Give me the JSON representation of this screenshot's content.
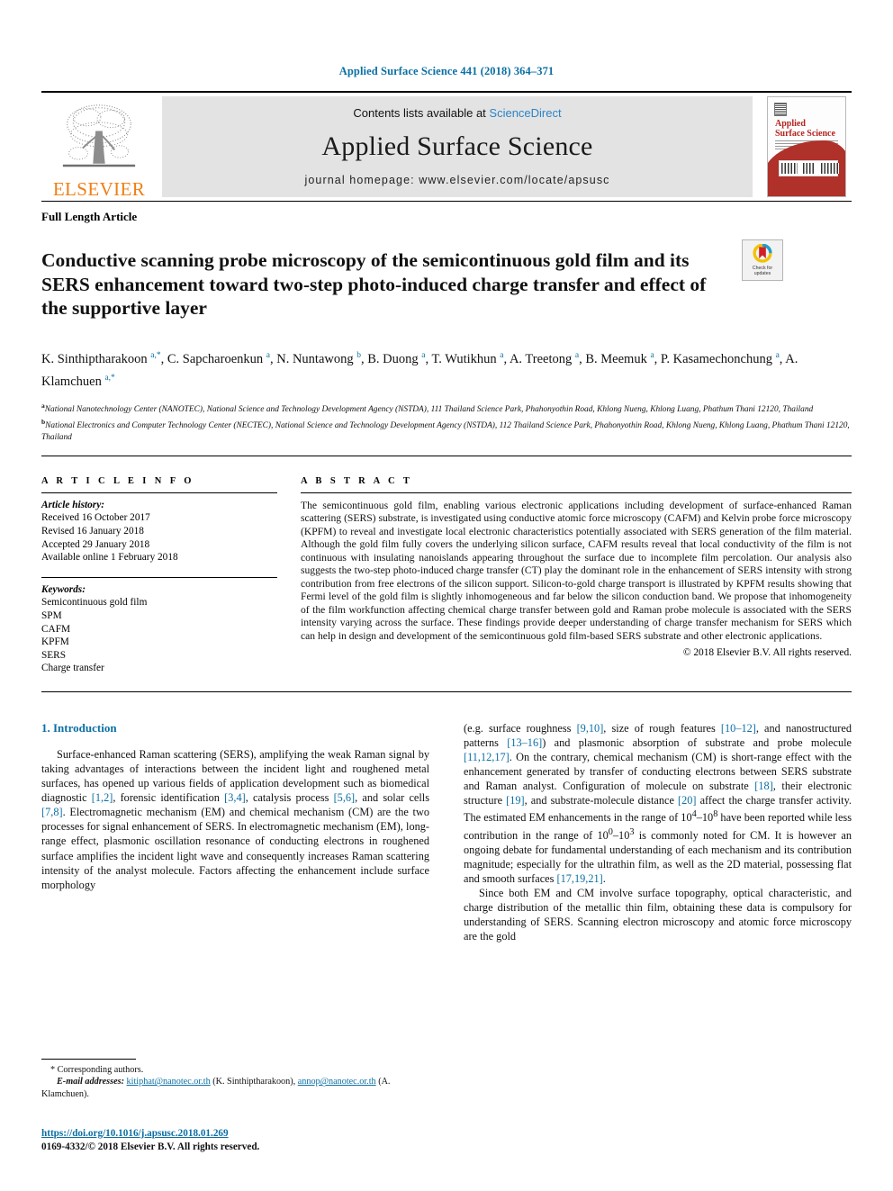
{
  "running_head": "Applied Surface Science 441 (2018) 364–371",
  "masthead": {
    "contents_prefix": "Contents lists available at ",
    "sciencedirect": "ScienceDirect",
    "journal_title": "Applied Surface Science",
    "homepage": "journal homepage: www.elsevier.com/locate/apsusc",
    "publisher_logo_text": "ELSEVIER",
    "cover_title_line1": "Applied",
    "cover_title_line2": "Surface Science",
    "accent_blue": "#2b84c8",
    "elsevier_orange": "#f07f13",
    "cover_red": "#b0302a"
  },
  "article_type": "Full Length Article",
  "title": "Conductive scanning probe microscopy of the semicontinuous gold film and its SERS enhancement toward two-step photo-induced charge transfer and effect of the supportive layer",
  "crossmark": {
    "line1": "Check for",
    "line2": "updates"
  },
  "authors_html": "K. Sinthiptharakoon <sup>a,*</sup>, C. Sapcharoenkun <sup>a</sup>, N. Nuntawong <sup>b</sup>, B. Duong <sup>a</sup>, T. Wutikhun <sup>a</sup>, A. Treetong <sup>a</sup>, B. Meemuk <sup>a</sup>, P. Kasamechonchung <sup>a</sup>, A. Klamchuen <sup>a,*</sup>",
  "affiliations": [
    "National Nanotechnology Center (NANOTEC), National Science and Technology Development Agency (NSTDA), 111 Thailand Science Park, Phahonyothin Road, Khlong Nueng, Khlong Luang, Phathum Thani 12120, Thailand",
    "National Electronics and Computer Technology Center (NECTEC), National Science and Technology Development Agency (NSTDA), 112 Thailand Science Park, Phahonyothin Road, Khlong Nueng, Khlong Luang, Phathum Thani 12120, Thailand"
  ],
  "affiliation_marks": [
    "a",
    "b"
  ],
  "article_info": {
    "heading": "A R T I C L E   I N F O",
    "history_label": "Article history:",
    "history": [
      "Received 16 October 2017",
      "Revised 16 January 2018",
      "Accepted 29 January 2018",
      "Available online 1 February 2018"
    ],
    "keywords_label": "Keywords:",
    "keywords": [
      "Semicontinuous gold film",
      "SPM",
      "CAFM",
      "KPFM",
      "SERS",
      "Charge transfer"
    ]
  },
  "abstract": {
    "heading": "A B S T R A C T",
    "text": "The semicontinuous gold film, enabling various electronic applications including development of surface-enhanced Raman scattering (SERS) substrate, is investigated using conductive atomic force microscopy (CAFM) and Kelvin probe force microscopy (KPFM) to reveal and investigate local electronic characteristics potentially associated with SERS generation of the film material. Although the gold film fully covers the underlying silicon surface, CAFM results reveal that local conductivity of the film is not continuous with insulating nanoislands appearing throughout the surface due to incomplete film percolation. Our analysis also suggests the two-step photo-induced charge transfer (CT) play the dominant role in the enhancement of SERS intensity with strong contribution from free electrons of the silicon support. Silicon-to-gold charge transport is illustrated by KPFM results showing that Fermi level of the gold film is slightly inhomogeneous and far below the silicon conduction band. We propose that inhomogeneity of the film workfunction affecting chemical charge transfer between gold and Raman probe molecule is associated with the SERS intensity varying across the surface. These findings provide deeper understanding of charge transfer mechanism for SERS which can help in design and development of the semicontinuous gold film-based SERS substrate and other electronic applications.",
    "copyright": "© 2018 Elsevier B.V. All rights reserved."
  },
  "introduction": {
    "section_title": "1. Introduction",
    "left_paragraph_html": "Surface-enhanced Raman scattering (SERS), amplifying the weak Raman signal by taking advantages of interactions between the incident light and roughened metal surfaces, has opened up various fields of application development such as biomedical diagnostic <span class=\"ref\">[1,2]</span>, forensic identification <span class=\"ref\">[3,4]</span>, catalysis process <span class=\"ref\">[5,6]</span>, and solar cells <span class=\"ref\">[7,8]</span>. Electromagnetic mechanism (EM) and chemical mechanism (CM) are the two processes for signal enhancement of SERS. In electromagnetic mechanism (EM), long-range effect, plasmonic oscillation resonance of conducting electrons in roughened surface amplifies the incident light wave and consequently increases Raman scattering intensity of the analyst molecule. Factors affecting the enhancement include surface morphology",
    "right_paragraph1_html": "(e.g. surface roughness <span class=\"ref\">[9,10]</span>, size of rough features <span class=\"ref\">[10–12]</span>, and nanostructured patterns <span class=\"ref\">[13–16]</span>) and plasmonic absorption of substrate and probe molecule <span class=\"ref\">[11,12,17]</span>. On the contrary, chemical mechanism (CM) is short-range effect with the enhancement generated by transfer of conducting electrons between SERS substrate and Raman analyst. Configuration of molecule on substrate <span class=\"ref\">[18]</span>, their electronic structure <span class=\"ref\">[19]</span>, and substrate-molecule distance <span class=\"ref\">[20]</span> affect the charge transfer activity. The estimated EM enhancements in the range of 10<sup>4</sup>–10<sup>8</sup> have been reported while less contribution in the range of 10<sup>0</sup>–10<sup>3</sup> is commonly noted for CM. It is however an ongoing debate for fundamental understanding of each mechanism and its contribution magnitude; especially for the ultrathin film, as well as the 2D material, possessing flat and smooth surfaces <span class=\"ref\">[17,19,21]</span>.",
    "right_paragraph2_html": "Since both EM and CM involve surface topography, optical characteristic, and charge distribution of the metallic thin film, obtaining these data is compulsory for understanding of SERS. Scanning electron microscopy and atomic force microscopy are the gold"
  },
  "footnote": {
    "corresponding": "* Corresponding authors.",
    "email_label": "E-mail addresses:",
    "email_1": "kitiphat@nanotec.or.th",
    "email_1_owner": "(K. Sinthiptharakoon),",
    "email_2": "annop@nanotec.or.th",
    "email_2_owner": "(A. Klamchuen)."
  },
  "doi": "https://doi.org/10.1016/j.apsusc.2018.01.269",
  "issn_line": "0169-4332/© 2018 Elsevier B.V. All rights reserved."
}
